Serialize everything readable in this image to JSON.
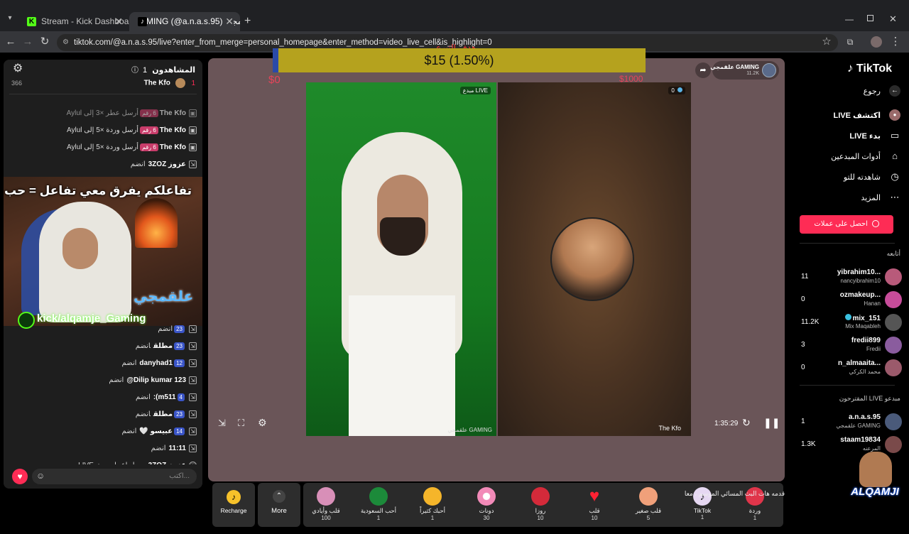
{
  "browser": {
    "tabs": [
      {
        "title": "Stream - Kick Dashboard"
      },
      {
        "title": "MING (@a.n.a.s.95) علقمجي"
      }
    ],
    "url": "tiktok.com/@a.n.a.s.95/live?enter_from_merge=personal_homepage&enter_method=video_live_cell&is_highlight=0"
  },
  "goal": {
    "title": "هدف التبرع",
    "amount": "$15 (1.50%)",
    "progress": 0.015,
    "min": "$0",
    "max": "$1000"
  },
  "chat": {
    "viewers_label": "المشاهدون",
    "viewers_count": "1",
    "viewer_count_side": "366",
    "top_user": "The Kfo",
    "top_rank": "1",
    "messages": [
      {
        "user": "The Kfo",
        "badge": "6 رقم",
        "text": "أرسل عطر ×3 إلى Aylul"
      },
      {
        "user": "The Kfo",
        "badge": "6 رقم",
        "text": "أرسل وردة ×5 إلى Aylul"
      },
      {
        "user": "The Kfo",
        "badge": "6 رقم",
        "text": "أرسل وردة ×5 إلى Aylul"
      },
      {
        "user": "عزوز 3ZOZ",
        "badge": "",
        "text": "انضم"
      },
      {
        "user": "",
        "badge": "23",
        "text": "انضم"
      },
      {
        "user": "مطلق",
        "badge": "23",
        "text": "انضم"
      },
      {
        "user": "danyhad1",
        "badge": "12",
        "text": "انضم"
      },
      {
        "user": "Dilip kumar 123@",
        "badge": "",
        "text": "انضم"
      },
      {
        "user": "m511):",
        "badge": "4",
        "text": "انضم"
      },
      {
        "user": "مطلق",
        "badge": "23",
        "text": "انضم"
      },
      {
        "user": "عبيسو 🤍",
        "badge": "14",
        "text": "انضم"
      },
      {
        "user": "11:11",
        "badge": "",
        "text": "انضم"
      },
      {
        "user": "عزوز 3ZOZ",
        "badge": "",
        "text": "سجل إعجابه ببث LIVE"
      }
    ],
    "input_placeholder": "اكتب..."
  },
  "overlay": {
    "banner": "تفاعلكم يفرق معي تفاعل = حب",
    "name": "علقمجي",
    "kick": "kick/alqamje_Gaming"
  },
  "stage": {
    "host_name": "علقمجي GAMING",
    "host_followers": "11.2K",
    "left_tag": "مبدع LIVE",
    "left_name": "علقمجي GAMING",
    "right_score": "0",
    "right_name": "The Kfo",
    "time": "1:35:29"
  },
  "gifts": [
    {
      "name": "Recharge",
      "price": ""
    },
    {
      "name": "More",
      "price": ""
    },
    {
      "name": "قلب وأيادي",
      "price": "100"
    },
    {
      "name": "أحب السعودية",
      "price": "1"
    },
    {
      "name": "أحبك كثيراً",
      "price": "1"
    },
    {
      "name": "دونات",
      "price": "30"
    },
    {
      "name": "روزا",
      "price": "10"
    },
    {
      "name": "قلب",
      "price": "10"
    },
    {
      "name": "قلب صغير",
      "price": "5"
    },
    {
      "name": "TikTok",
      "price": "1"
    },
    {
      "name": "وردة",
      "price": "1"
    }
  ],
  "caption": "قدمه هات البث المسائي  الموسم ، معا",
  "sidebar": {
    "logo": "TikTok",
    "back": "رجوع",
    "menu": [
      "اكتشف LIVE",
      "بدء LIVE",
      "أدوات المبدعين",
      "شاهدته للتو",
      "المزيد"
    ],
    "coins_btn": "احصل على عملات",
    "following_title": "أتابعه",
    "following": [
      {
        "name": "yibrahim10...",
        "sub": "nancyibrahim10",
        "count": "11",
        "color": "#b85a7a"
      },
      {
        "name": "ozmakeup...",
        "sub": "Hanan",
        "count": "0",
        "color": "#c74c9a"
      },
      {
        "name": "mix_151",
        "sub": "Mix Maqableh",
        "count": "11.2K",
        "color": "#555"
      },
      {
        "name": "fredii899",
        "sub": "Fredii",
        "count": "3",
        "color": "#8a5c9e"
      },
      {
        "name": "n_almaaita...",
        "sub": "محمد الكركي",
        "count": "0",
        "color": "#9b5a6b"
      }
    ],
    "suggested_title": "مبدعو LIVE المقترحون",
    "suggested": [
      {
        "name": "a.n.a.s.95",
        "sub": "علقمجي GAMING",
        "count": "1",
        "color": "#4a5a7a"
      },
      {
        "name": "staam19834",
        "sub": "المرعنه",
        "count": "1.3K",
        "color": "#7a4a4a"
      }
    ],
    "watermark": "ALQAMJI"
  }
}
